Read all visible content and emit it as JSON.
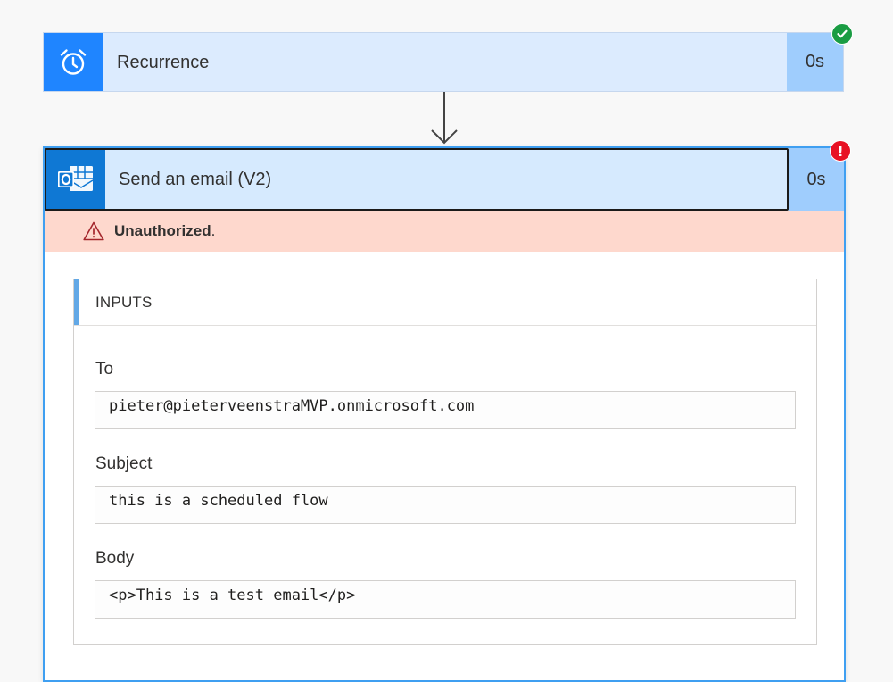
{
  "recurrence": {
    "title": "Recurrence",
    "duration": "0s",
    "status_icon": "check-circle-icon",
    "status_color": "#1a9c43",
    "icon": "alarm-clock-icon",
    "icon_bg": "#1f85ff"
  },
  "send_email": {
    "title": "Send an email (V2)",
    "duration": "0s",
    "status_icon": "error-circle-icon",
    "status_color": "#e81123",
    "icon": "outlook-icon",
    "icon_bg": "#0f78d4",
    "error": {
      "icon": "warning-triangle-icon",
      "message_bold": "Unauthorized",
      "message_suffix": "."
    },
    "inputs": {
      "heading": "INPUTS",
      "fields": [
        {
          "label": "To",
          "value": "pieter@pieterveenstraMVP.onmicrosoft.com"
        },
        {
          "label": "Subject",
          "value": "this is a scheduled flow"
        },
        {
          "label": "Body",
          "value": "<p>This is a test email</p>"
        }
      ]
    }
  }
}
